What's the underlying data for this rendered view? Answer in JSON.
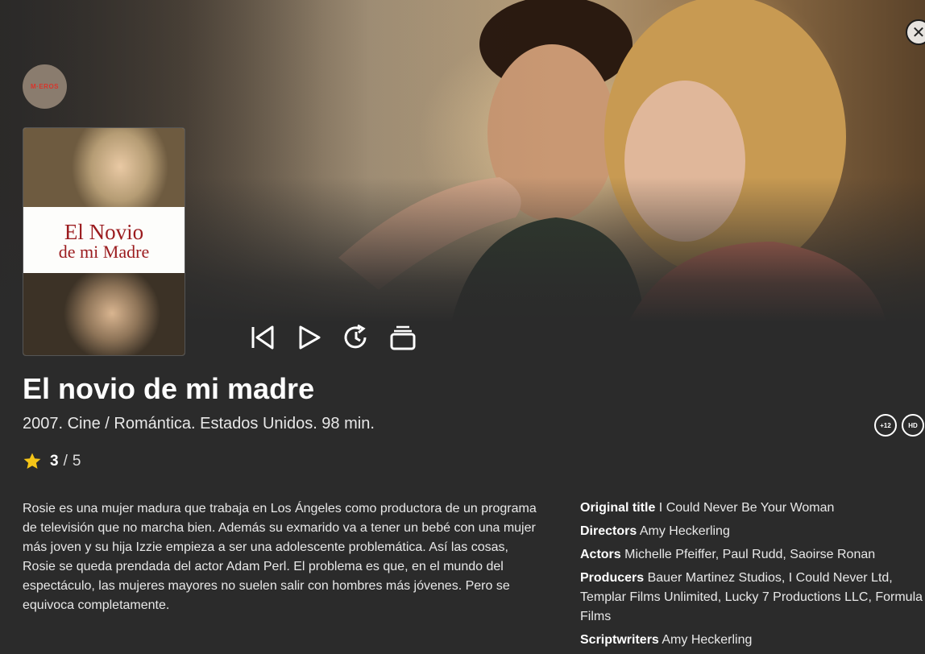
{
  "close": {
    "icon": "close-icon"
  },
  "channel": {
    "logo_text": "M·EROS"
  },
  "poster": {
    "title_line1": "El Novio",
    "title_line2": "de mi Madre"
  },
  "controls": [
    {
      "icon": "restart-icon"
    },
    {
      "icon": "play-icon"
    },
    {
      "icon": "replay-icon"
    },
    {
      "icon": "episodes-icon"
    }
  ],
  "movie": {
    "title": "El novio de mi madre",
    "meta": "2007. Cine / Romántica. Estados Unidos. 98 min.",
    "badges": [
      "+12",
      "HD"
    ],
    "rating": {
      "value": "3",
      "separator": "/",
      "max": "5",
      "stars_filled": 1
    },
    "synopsis": "Rosie es una mujer madura que trabaja en Los Ángeles como productora de un programa de televisión que no marcha bien. Además su exmarido va a tener un bebé con una mujer más joven y su hija Izzie empieza a ser una adolescente problemática. Así las cosas, Rosie se queda prendada del actor Adam Perl. El problema es que, en el mundo del espectáculo, las mujeres mayores no suelen salir con hombres más jóvenes. Pero se equivoca completamente."
  },
  "credits": [
    {
      "label": "Original title",
      "value": "I Could Never Be Your Woman"
    },
    {
      "label": "Directors",
      "value": "Amy Heckerling"
    },
    {
      "label": "Actors",
      "value": "Michelle Pfeiffer, Paul Rudd, Saoirse Ronan"
    },
    {
      "label": "Producers",
      "value": "Bauer Martinez Studios, I Could Never Ltd, Templar Films Unlimited, Lucky 7 Productions LLC, Formula Films"
    },
    {
      "label": "Scriptwriters",
      "value": "Amy Heckerling"
    }
  ],
  "colors": {
    "background": "#2b2b2b",
    "star": "#f5c518",
    "poster_title": "#9b1b1e"
  }
}
